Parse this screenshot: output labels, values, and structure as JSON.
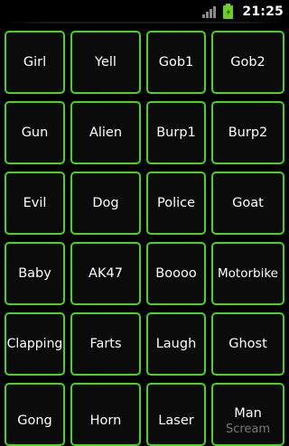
{
  "status_bar": {
    "time": "21:25",
    "signal_icon": "signal-icon",
    "battery_icon": "battery-charging-icon"
  },
  "grid": {
    "rows": [
      [
        "Girl",
        "Yell",
        "Gob1",
        "Gob2"
      ],
      [
        "Gun",
        "Alien",
        "Burp1",
        "Burp2"
      ],
      [
        "Evil",
        "Dog",
        "Police",
        "Goat"
      ],
      [
        "Baby",
        "AK47",
        "Boooo",
        "Motorbike"
      ],
      [
        "Clapping",
        "Farts",
        "Laugh",
        "Ghost"
      ],
      [
        "Gong",
        "Horn",
        "Laser",
        "Man"
      ]
    ],
    "overflow_label": "Scream"
  },
  "colors": {
    "accent": "#46d51c",
    "background": "#000000",
    "battery": "#6ccf23"
  }
}
